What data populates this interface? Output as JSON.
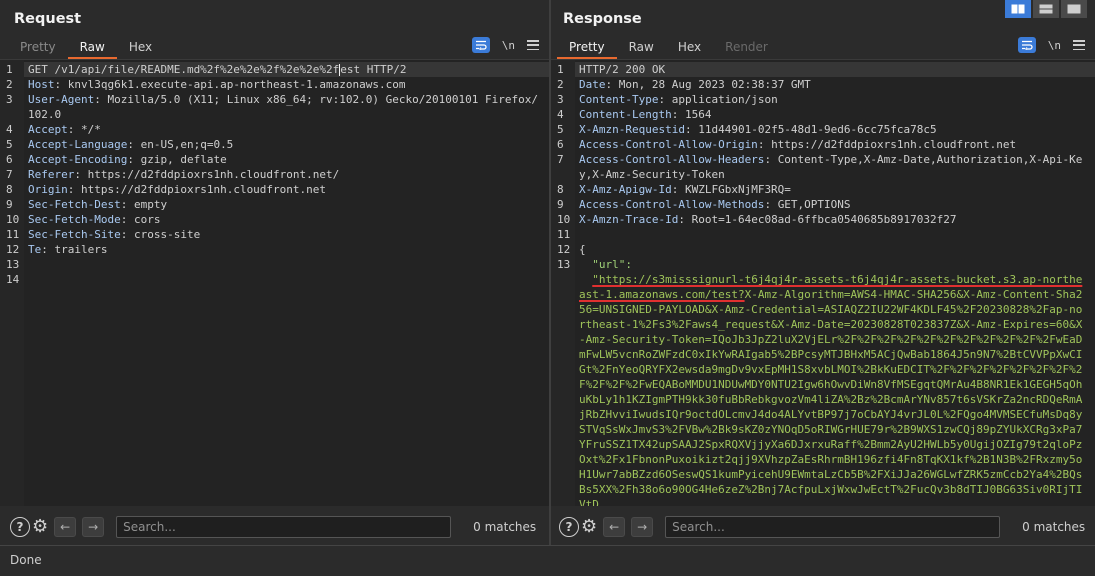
{
  "request": {
    "title": "Request",
    "tabs": [
      "Pretty",
      "Raw",
      "Hex"
    ],
    "active_tab": "Raw",
    "newline_toggle": "\\n",
    "lines": [
      {
        "num": "1",
        "content": "GET /v1/api/file/README.md%2f%2e%2e%2f%2e%2e%2f",
        "content_b": "est HTTP/2",
        "type": "request_line"
      },
      {
        "num": "2",
        "name": "Host",
        "value": "knvl3qg6k1.execute-api.ap-northeast-1.amazonaws.com"
      },
      {
        "num": "3",
        "name": "User-Agent",
        "value": "Mozilla/5.0 (X11; Linux x86_64; rv:102.0) Gecko/20100101 Firefox/102.0"
      },
      {
        "num": "4",
        "name": "Accept",
        "value": "*/*"
      },
      {
        "num": "5",
        "name": "Accept-Language",
        "value": "en-US,en;q=0.5"
      },
      {
        "num": "6",
        "name": "Accept-Encoding",
        "value": "gzip, deflate"
      },
      {
        "num": "7",
        "name": "Referer",
        "value": "https://d2fddpioxrs1nh.cloudfront.net/"
      },
      {
        "num": "8",
        "name": "Origin",
        "value": "https://d2fddpioxrs1nh.cloudfront.net"
      },
      {
        "num": "9",
        "name": "Sec-Fetch-Dest",
        "value": "empty"
      },
      {
        "num": "10",
        "name": "Sec-Fetch-Mode",
        "value": "cors"
      },
      {
        "num": "11",
        "name": "Sec-Fetch-Site",
        "value": "cross-site"
      },
      {
        "num": "12",
        "name": "Te",
        "value": "trailers"
      },
      {
        "num": "13",
        "content": ""
      },
      {
        "num": "14",
        "content": ""
      }
    ],
    "search_placeholder": "Search...",
    "matches": "0 matches"
  },
  "response": {
    "title": "Response",
    "tabs": [
      "Pretty",
      "Raw",
      "Hex",
      "Render"
    ],
    "active_tab": "Pretty",
    "newline_toggle": "\\n",
    "lines": [
      {
        "num": "1",
        "content": "HTTP/2 200 OK"
      },
      {
        "num": "2",
        "name": "Date",
        "value": "Mon, 28 Aug 2023 02:38:37 GMT"
      },
      {
        "num": "3",
        "name": "Content-Type",
        "value": "application/json"
      },
      {
        "num": "4",
        "name": "Content-Length",
        "value": "1564"
      },
      {
        "num": "5",
        "name": "X-Amzn-Requestid",
        "value": "11d44901-02f5-48d1-9ed6-6cc75fca78c5"
      },
      {
        "num": "6",
        "name": "Access-Control-Allow-Origin",
        "value": "https://d2fddpioxrs1nh.cloudfront.net"
      },
      {
        "num": "7",
        "name": "Access-Control-Allow-Headers",
        "value": "Content-Type,X-Amz-Date,Authorization,X-Api-Key,X-Amz-Security-Token"
      },
      {
        "num": "8",
        "name": "X-Amz-Apigw-Id",
        "value": "KWZLFGbxNjMF3RQ="
      },
      {
        "num": "9",
        "name": "Access-Control-Allow-Methods",
        "value": "GET,OPTIONS"
      },
      {
        "num": "10",
        "name": "X-Amzn-Trace-Id",
        "value": "Root=1-64ec08ad-6ffbca0540685b8917032f27"
      },
      {
        "num": "11",
        "content": ""
      },
      {
        "num": "12",
        "content": "{"
      }
    ],
    "json_key": "\"url\":",
    "json_value_underlined": "\"https://s3misssignurl-t6j4qj4r-assets-t6j4qj4r-assets-bucket.s3.ap-northeast-1.amazonaws.com/test?",
    "json_value_rest": "X-Amz-Algorithm=AWS4-HMAC-SHA256&X-Amz-Content-Sha256=UNSIGNED-PAYLOAD&X-Amz-Credential=ASIAQZ2IU22WF4KDLF45%2F20230828%2Fap-northeast-1%2Fs3%2Faws4_request&X-Amz-Date=20230828T023837Z&X-Amz-Expires=60&X-Amz-Security-Token=IQoJb3JpZ2luX2VjELr%2F%2F%2F%2F%2F%2F%2F%2F%2F%2F%2FwEaDmFwLW5vcnRoZWFzdC0xIkYwRAIgab5%2BPcsyMTJBHxM5ACjQwBab1864J5n9N7%2BtCVVPpXwCIGt%2FnYeoQRYFX2ewsda9mgDv9vxEpMH1S8xvbLMOI%2BkKuEDCIT%2F%2F%2F%2F%2F%2F%2F%2F%2F%2F%2FwEQABoMMDU1NDUwMDY0NTU2Igw6hOwvDiWn8VfMSEgqtQMrAu4B8NR1Ek1GEGH5qOhuKbLy1h1KZIgmPTH9kk30fuBbRebkgvozVm4liZA%2Bz%2BcmArYNv857t6sVSKrZa2ncRDQeRmAjRbZHvviIwudsIQr9octdOLcmvJ4do4ALYvtBP97j7oCbAYJ4vrJL0L%2FQgo4MVMSECfuMsDq8ySTVqSsWxJmvS3%2FVBw%2Bk9sKZ0zYNOqD5oRIWGrHUE79r%2B9WXS1zwCQj89pZYUkXCRg3xPa7YFruSSZ1TX42upSAAJ2SpxRQXVjjyXa6DJxrxuRaff%2Bmm2AyU2HWLb5y0UgijOZIg79t2qloPzOxt%2Fx1FbnonPuxoikizt2qjj9XVhzpZaEsRhrmBH196zfi4Fn8TqKX1kf%2B1N3B%2FRxzmy5oH1Uwr7abBZzd6OSeswQS1kumPyicehU9EWmtaLzCb5B%2FXiJJa26WGLwfZRK5zmCcb2Ya4%2BQsBs5XX%2Fh38o6o90OG4He6zeZ%2Bnj7AcfpuLxjWxwJwEctT%2FucQv3b8dTIJ0BG63Siv0RIjTIVtD",
    "search_placeholder": "Search...",
    "matches": "0 matches"
  },
  "status": "Done",
  "icons": {
    "help": "?",
    "settings": "⚙",
    "prev": "←",
    "next": "→"
  },
  "colors": {
    "accent": "#e8692f",
    "blue": "#3b7bd8",
    "header_name": "#a9c9f1",
    "json_green": "#9fc45a",
    "underline": "#e03030"
  }
}
